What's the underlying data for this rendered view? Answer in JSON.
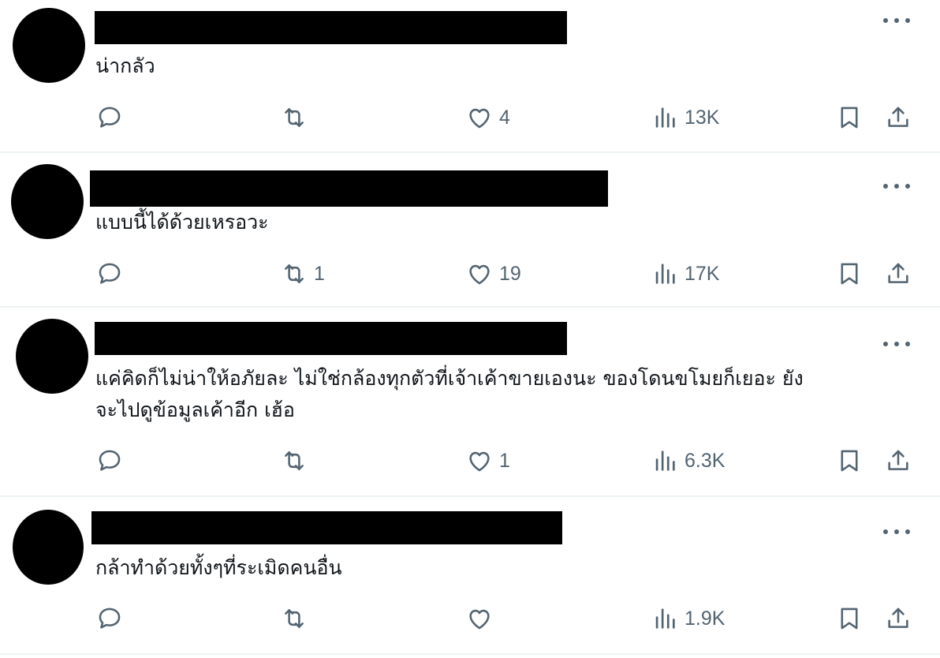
{
  "posts": [
    {
      "text": "น่ากลัว",
      "replies": "",
      "reposts": "",
      "likes": "4",
      "views": "13K"
    },
    {
      "text": "แบบนี้ได้ด้วยเหรอวะ",
      "replies": "",
      "reposts": "1",
      "likes": "19",
      "views": "17K"
    },
    {
      "text_line1": "แค่คิดก็ไม่น่าให้อภัยละ ไม่ใช่กล้องทุกตัวที่เจ้าเค้าขายเองนะ ของโดนขโมยก็เยอะ ยัง",
      "text_line2": "จะไปดูข้อมูลเค้าอีก เฮ้อ",
      "replies": "",
      "reposts": "",
      "likes": "1",
      "views": "6.3K"
    },
    {
      "text": "กล้าทำด้วยทั้งๆที่ระเมิดคนอื่น",
      "replies": "",
      "reposts": "",
      "likes": "",
      "views": "1.9K"
    }
  ],
  "icons": {
    "reply": "speech-bubble-icon",
    "repost": "repost-arrows-icon",
    "like": "heart-icon",
    "views": "bar-chart-icon",
    "bookmark": "bookmark-icon",
    "share": "share-upload-icon",
    "more": "more-dots-icon"
  },
  "colors": {
    "icon_gray": "#536471",
    "text": "#0f1419",
    "divider": "#eff3f4"
  }
}
